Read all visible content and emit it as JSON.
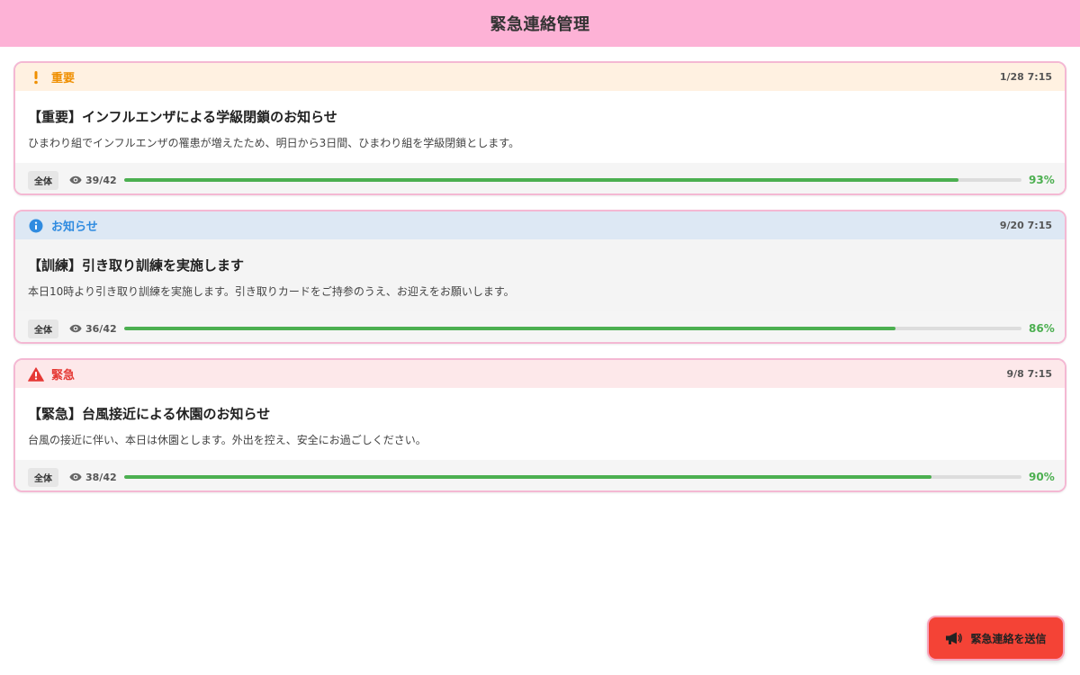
{
  "header": {
    "title": "緊急連絡管理"
  },
  "notices": [
    {
      "level": "important",
      "level_label": "重要",
      "icon": "exclamation-icon",
      "accent": "#ef8f00",
      "timestamp": "1/28 7:15",
      "title": "【重要】インフルエンザによる学級閉鎖のお知らせ",
      "body": "ひまわり組でインフルエンザの罹患が増えたため、明日から3日間、ひまわり組を学級閉鎖とします。",
      "audience": "全体",
      "read_count": "39/42",
      "read_percent_label": "93%",
      "read_fraction": 0.93
    },
    {
      "level": "info",
      "level_label": "お知らせ",
      "icon": "info-icon",
      "accent": "#2f8be0",
      "timestamp": "9/20 7:15",
      "title": "【訓練】引き取り訓練を実施します",
      "body": "本日10時より引き取り訓練を実施します。引き取りカードをご持参のうえ、お迎えをお願いします。",
      "audience": "全体",
      "read_count": "36/42",
      "read_percent_label": "86%",
      "read_fraction": 0.86
    },
    {
      "level": "urgent",
      "level_label": "緊急",
      "icon": "warning-triangle-icon",
      "accent": "#e53935",
      "timestamp": "9/8 7:15",
      "title": "【緊急】台風接近による休園のお知らせ",
      "body": "台風の接近に伴い、本日は休園とします。外出を控え、安全にお過ごしください。",
      "audience": "全体",
      "read_count": "38/42",
      "read_percent_label": "90%",
      "read_fraction": 0.9
    }
  ],
  "actions": {
    "send_label": "緊急連絡を送信",
    "send_icon": "megaphone-icon"
  },
  "colors": {
    "header_bg": "#fdb2d6",
    "progress": "#4caf50",
    "send_button": "#f44336"
  }
}
